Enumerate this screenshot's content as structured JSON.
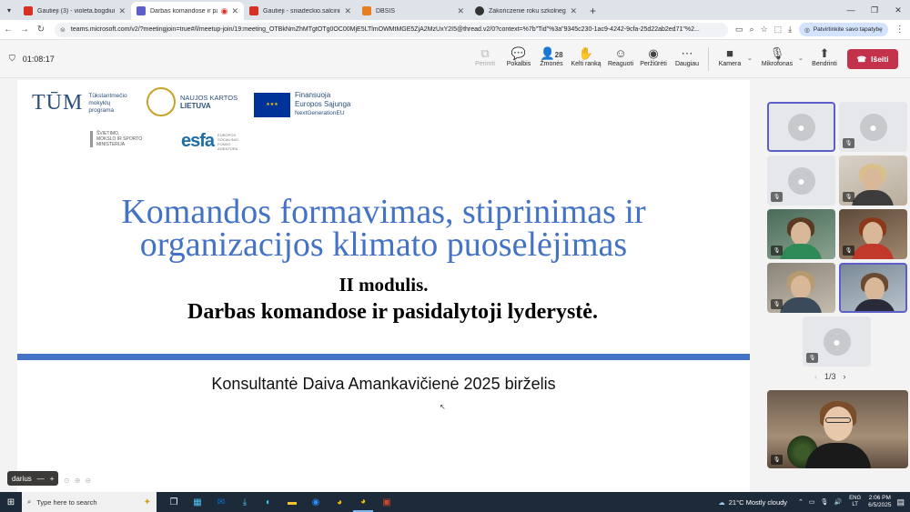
{
  "browser": {
    "tabs": [
      {
        "title": "Gautieji (3) - violeta.bogdiun@...",
        "icon": "gmail-icon",
        "color": "#d93025",
        "active": false
      },
      {
        "title": "Darbas komandose ir pasid...",
        "icon": "teams-icon",
        "color": "#5b5fc7",
        "active": true
      },
      {
        "title": "Gautieji - sniadeckio.salcininkai...",
        "icon": "gmail-icon",
        "color": "#d93025",
        "active": false
      },
      {
        "title": "DBSIS",
        "icon": "dbsis-icon",
        "color": "#e67e22",
        "active": false
      },
      {
        "title": "Zakończenie roku szkolnego",
        "icon": "globe-icon",
        "color": "#333333",
        "active": false
      }
    ],
    "url": "teams.microsoft.com/v2/?meetingjoin=true#/l/meetup-join/19:meeting_OTBkNmZhMTgtOTg0OC00MjE5LTlmOWMtMGE5ZjA2MzUxY2I5@thread.v2/0?context=%7b\"Tid\"%3a\"9345c230-1ac9-4242-9cfa-25d22ab2ed71\"%2...",
    "verify_label": "Patvirtinkite savo tapatybę"
  },
  "meeting": {
    "timer": "01:08:17",
    "buttons": [
      {
        "label": "Perimti",
        "icon": "share-screen-icon",
        "glyph": "⧉",
        "enabled": false
      },
      {
        "label": "Pokalbis",
        "icon": "chat-icon",
        "glyph": "💬",
        "enabled": true
      },
      {
        "label": "Žmonės",
        "icon": "people-icon",
        "glyph": "👥",
        "enabled": true,
        "count": "28"
      },
      {
        "label": "Kelti ranką",
        "icon": "raise-hand-icon",
        "glyph": "✋",
        "enabled": true
      },
      {
        "label": "Reaguoti",
        "icon": "react-icon",
        "glyph": "☺",
        "enabled": true
      },
      {
        "label": "Peržiūrėti",
        "icon": "view-icon",
        "glyph": "◉",
        "enabled": true
      },
      {
        "label": "Daugiau",
        "icon": "more-icon",
        "glyph": "⋯",
        "enabled": true
      },
      {
        "label": "Kamera",
        "icon": "camera-icon",
        "glyph": "■",
        "enabled": true
      },
      {
        "label": "Mikrofonas",
        "icon": "mic-off-icon",
        "glyph": "🎙",
        "enabled": true
      },
      {
        "label": "Bendrinti",
        "icon": "share-icon",
        "glyph": "⬆",
        "enabled": true
      }
    ],
    "leave_label": "Išeiti"
  },
  "slide": {
    "logos": {
      "tum_big": "TŪM",
      "tum_small": [
        "Tūkstantmečio",
        "mokyklų",
        "programa"
      ],
      "nk_lines": [
        "NAUJOS KARTOS",
        "LIETUVA"
      ],
      "eu_lines": [
        "Finansuoja",
        "Europos Sąjunga",
        "NextGenerationEU"
      ],
      "ministry_lines": [
        "ŠVIETIMO,",
        "MOKSLO IR SPORTO",
        "MINISTERIJA"
      ],
      "esfa": "esfa",
      "esfa_sub": [
        "EUROPOS",
        "SOCIALINIO",
        "FONDO",
        "AGENTŪRA"
      ]
    },
    "title_line1": "Komandos formavimas, stiprinimas ir",
    "title_line2": "organizacijos klimato puoselėjimas",
    "module": "II modulis.",
    "subtitle": "Darbas komandose ir pasidalytoji lyderystė.",
    "consultant": "Konsultantė Daiva Amankavičienė 2025 birželis"
  },
  "presenter_tag": "darius",
  "gallery": {
    "page": "1/3"
  },
  "taskbar": {
    "search_placeholder": "Type here to search",
    "weather": "21°C  Mostly cloudy",
    "lang": [
      "ENG",
      "LT"
    ],
    "time": "2:06 PM",
    "date": "6/5/2025"
  },
  "colors": {
    "accent": "#5b5fc7",
    "leave": "#c4314b",
    "slide_blue": "#4472c4"
  }
}
